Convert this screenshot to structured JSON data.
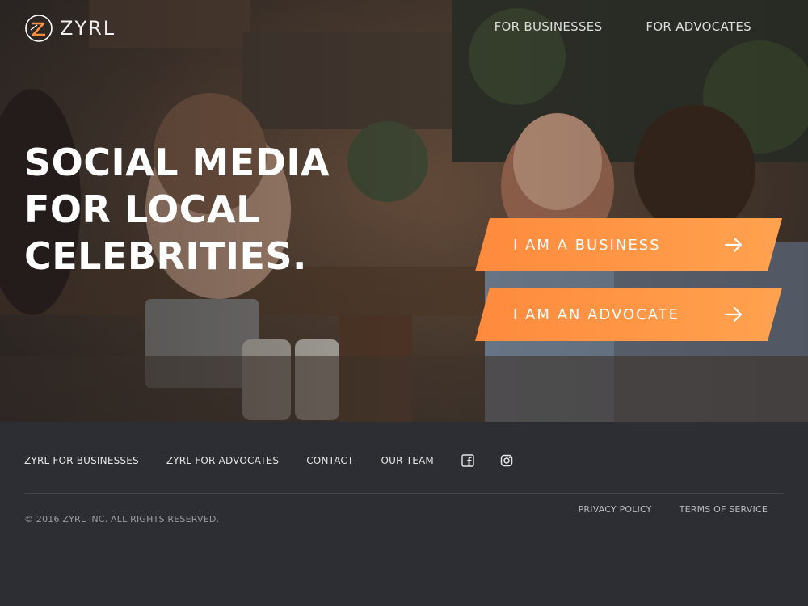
{
  "brand": {
    "name": "ZYRL",
    "accent": "#ff9040",
    "footer_bg": "#2c2e33"
  },
  "nav": {
    "items": [
      {
        "label": "FOR BUSINESSES"
      },
      {
        "label": "FOR ADVOCATES"
      }
    ]
  },
  "hero": {
    "headline": [
      "SOCIAL MEDIA",
      "FOR LOCAL",
      "CELEBRITIES."
    ],
    "background": "photo-of-people-at-cafe-table-with-devices",
    "ctas": [
      {
        "label": "I AM A BUSINESS",
        "icon": "arrow-right-icon"
      },
      {
        "label": "I AM AN ADVOCATE",
        "icon": "arrow-right-icon"
      }
    ]
  },
  "footer": {
    "links": [
      {
        "label": "ZYRL FOR BUSINESSES"
      },
      {
        "label": "ZYRL FOR ADVOCATES"
      },
      {
        "label": "CONTACT"
      },
      {
        "label": "OUR TEAM"
      }
    ],
    "social": [
      "facebook-icon",
      "instagram-icon"
    ],
    "copyright": "© 2016 ZYRL INC. ALL RIGHTS RESERVED.",
    "legal": [
      {
        "label": "PRIVACY POLICY"
      },
      {
        "label": "TERMS OF SERVICE"
      }
    ]
  }
}
